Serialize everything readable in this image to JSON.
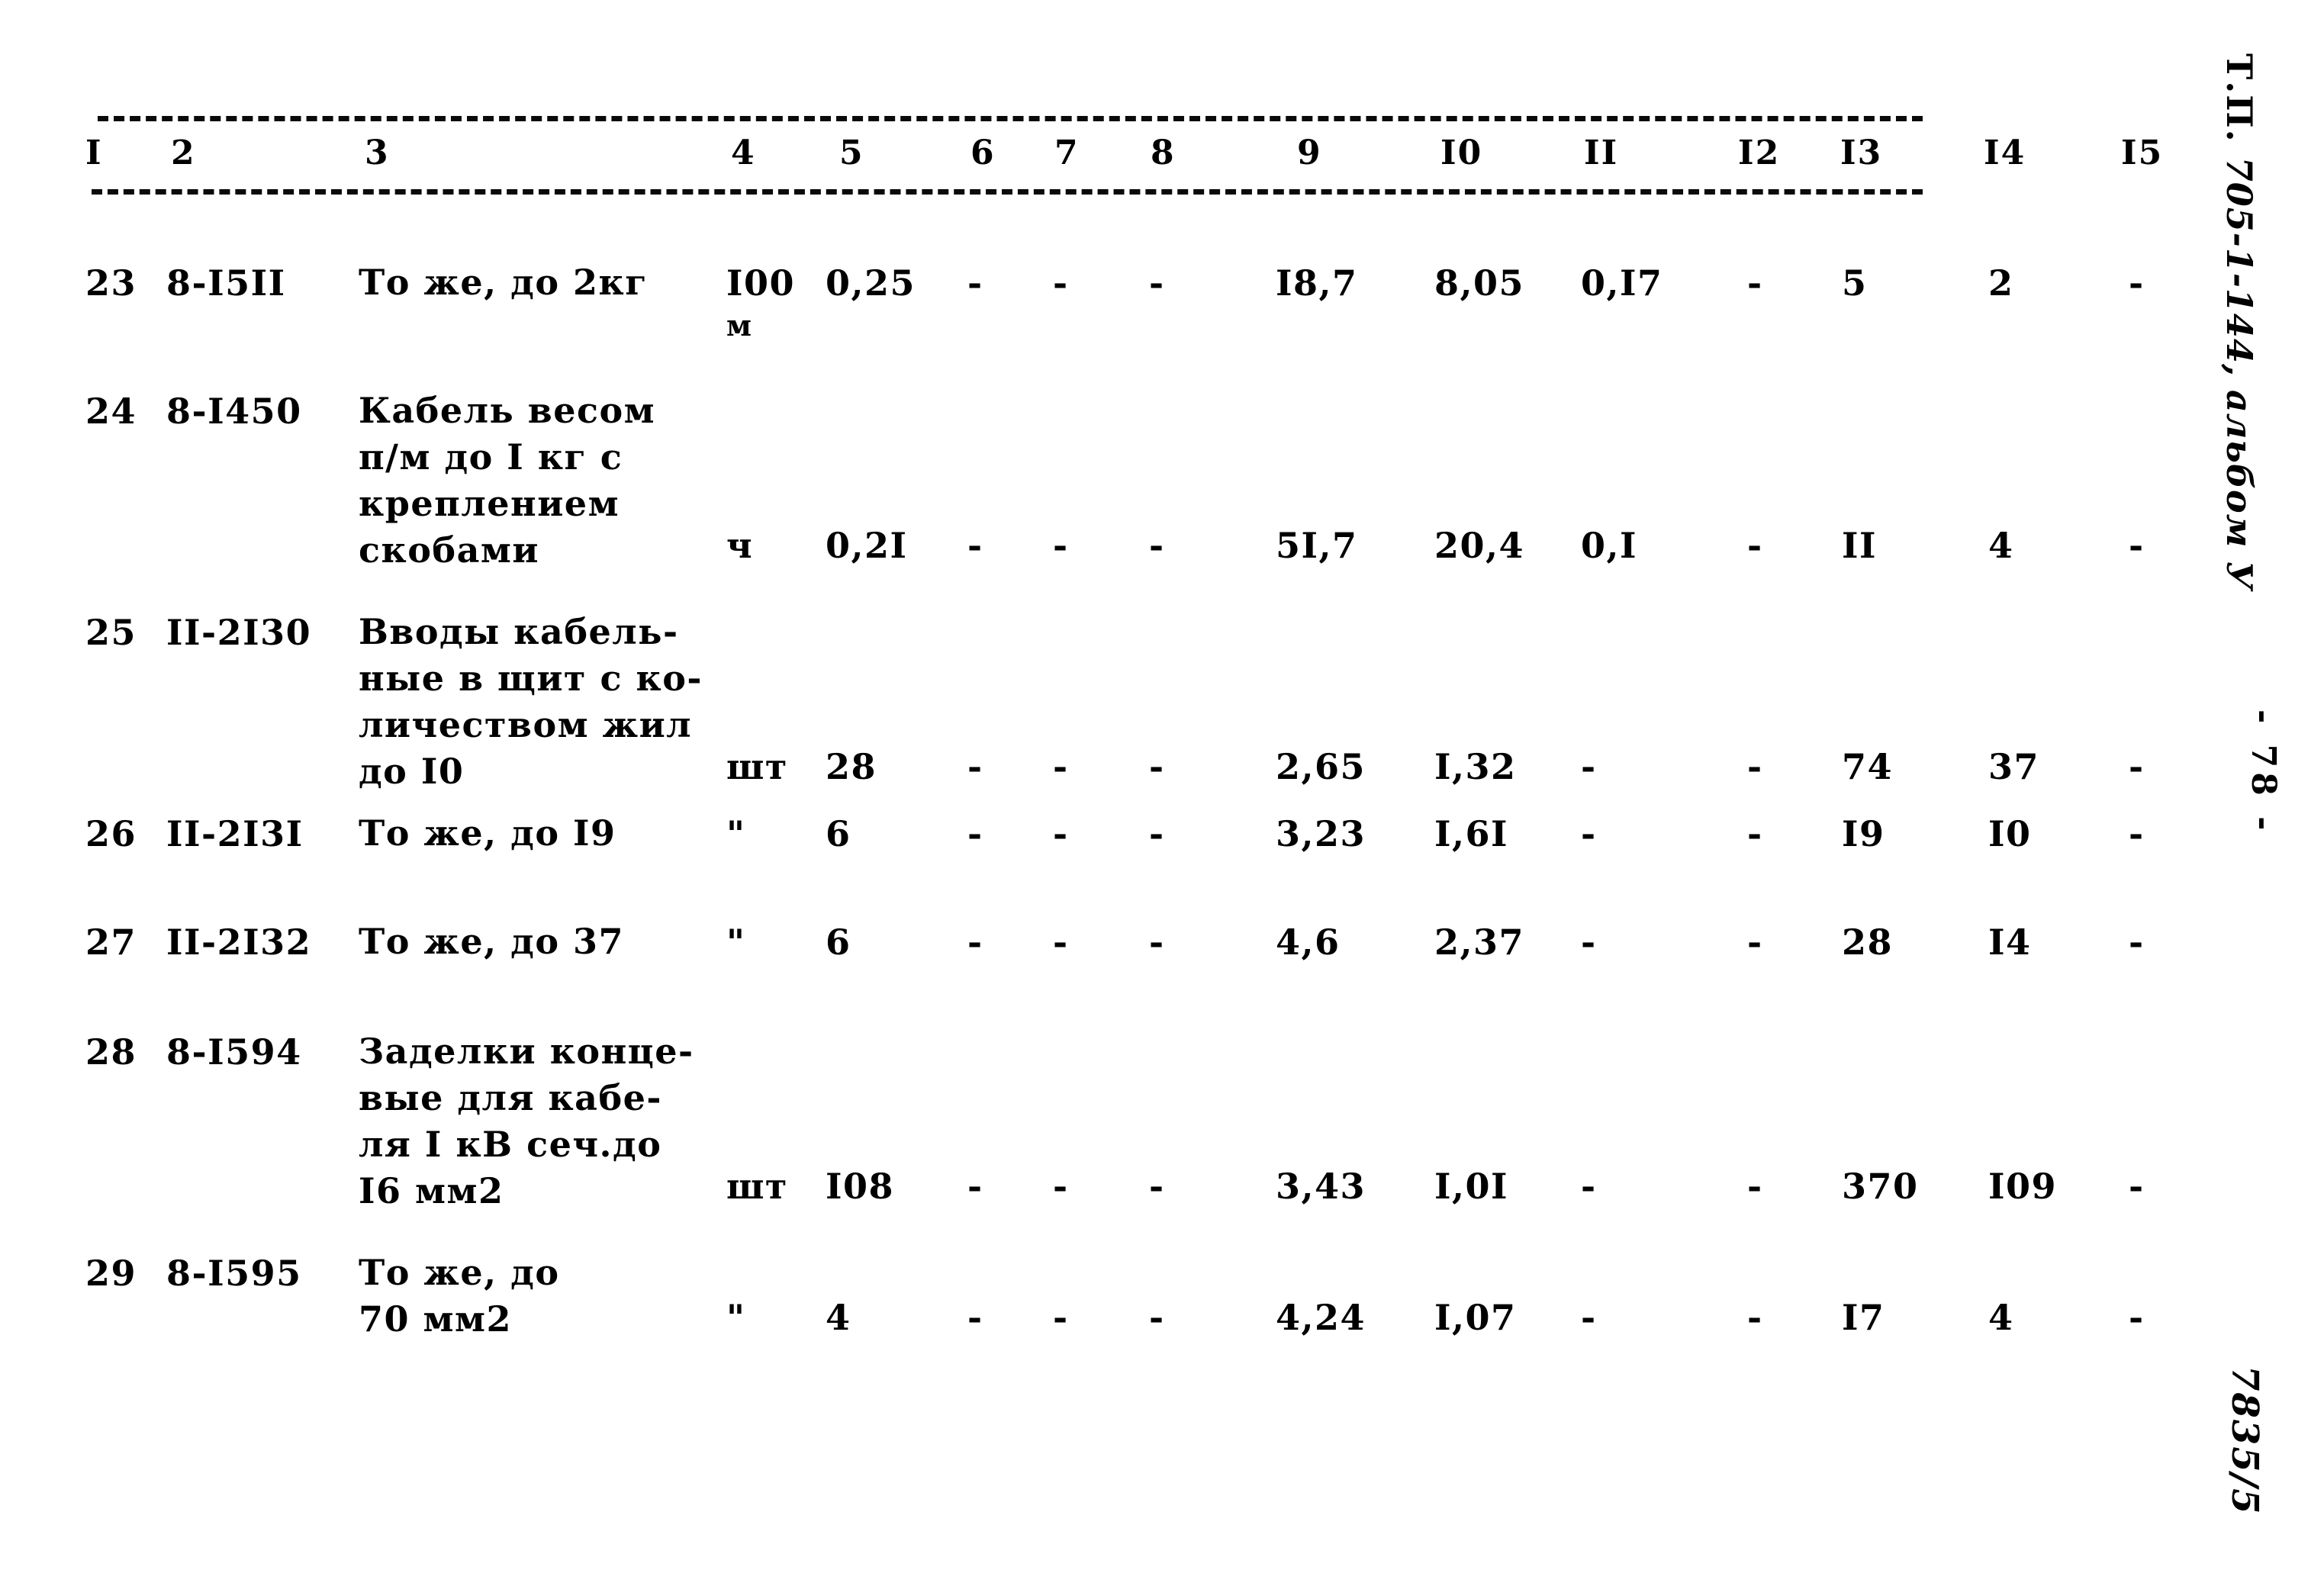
{
  "document": {
    "margin_doc_ref_prefix": "Т.П.",
    "margin_doc_ref_hand": "705-1-144, альбом У",
    "margin_page_no": "- 78 -",
    "margin_stamp": "7835/5"
  },
  "table": {
    "column_headers": [
      "I",
      "2",
      "3",
      "4",
      "5",
      "6",
      "7",
      "8",
      "9",
      "I0",
      "II",
      "I2",
      "I3",
      "I4",
      "I5"
    ],
    "rows": [
      {
        "no": "23",
        "code": "8-I5II",
        "description": "То же, до 2кг",
        "unit": "I00",
        "unit_sub": "м",
        "c5": "0,25",
        "c6": "-",
        "c7": "-",
        "c8": "-",
        "c9": "I8,7",
        "c10": "8,05",
        "c11": "0,I7",
        "c12": "-",
        "c13": "5",
        "c14": "2",
        "c15": "-"
      },
      {
        "no": "24",
        "code": "8-I450",
        "description": "Кабель весом\nп/м до I кг с\nкреплением\nскобами",
        "unit": "ч",
        "unit_sub": "",
        "c5": "0,2I",
        "c6": "-",
        "c7": "-",
        "c8": "-",
        "c9": "5I,7",
        "c10": "20,4",
        "c11": "0,I",
        "c12": "-",
        "c13": "II",
        "c14": "4",
        "c15": "-"
      },
      {
        "no": "25",
        "code": "II-2I30",
        "description": "Вводы кабель-\nные в щит с ко-\nличеством жил\nдо I0",
        "unit": "шт",
        "unit_sub": "",
        "c5": "28",
        "c6": "-",
        "c7": "-",
        "c8": "-",
        "c9": "2,65",
        "c10": "I,32",
        "c11": "-",
        "c12": "-",
        "c13": "74",
        "c14": "37",
        "c15": "-"
      },
      {
        "no": "26",
        "code": "II-2I3I",
        "description": "То же, до I9",
        "unit": "\"",
        "unit_sub": "",
        "c5": "6",
        "c6": "-",
        "c7": "-",
        "c8": "-",
        "c9": "3,23",
        "c10": "I,6I",
        "c11": "-",
        "c12": "-",
        "c13": "I9",
        "c14": "I0",
        "c15": "-"
      },
      {
        "no": "27",
        "code": "II-2I32",
        "description": "То же, до 37",
        "unit": "\"",
        "unit_sub": "",
        "c5": "6",
        "c6": "-",
        "c7": "-",
        "c8": "-",
        "c9": "4,6",
        "c10": "2,37",
        "c11": "-",
        "c12": "-",
        "c13": "28",
        "c14": "I4",
        "c15": "-"
      },
      {
        "no": "28",
        "code": "8-I594",
        "description": "Заделки конце-\nвые для кабе-\nля I кВ сеч.до\nI6 мм2",
        "unit": "шт",
        "unit_sub": "",
        "c5": "I08",
        "c6": "-",
        "c7": "-",
        "c8": "-",
        "c9": "3,43",
        "c10": "I,0I",
        "c11": "-",
        "c12": "-",
        "c13": "370",
        "c14": "I09",
        "c15": "-"
      },
      {
        "no": "29",
        "code": "8-I595",
        "description": "То же, до\n70 мм2",
        "unit": "\"",
        "unit_sub": "",
        "c5": "4",
        "c6": "-",
        "c7": "-",
        "c8": "-",
        "c9": "4,24",
        "c10": "I,07",
        "c11": "-",
        "c12": "-",
        "c13": "I7",
        "c14": "4",
        "c15": "-"
      }
    ]
  }
}
